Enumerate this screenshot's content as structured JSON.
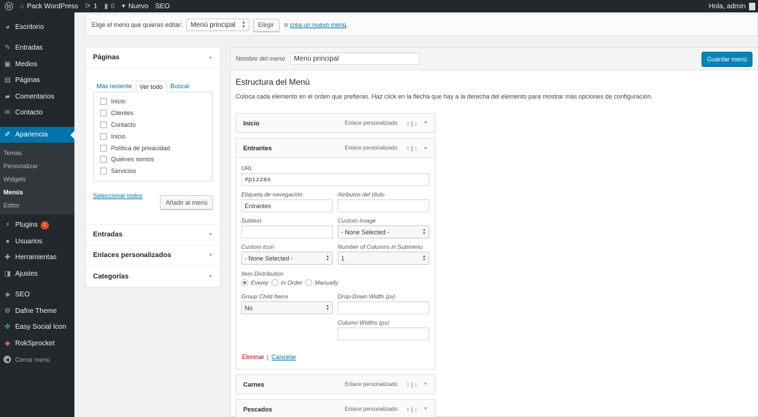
{
  "adminbar": {
    "site_name": "Pack WordPress",
    "updates_count": "1",
    "comments_count": "0",
    "new_label": "Nuevo",
    "seo_label": "SEO",
    "greeting": "Hola, admin"
  },
  "sidebar": {
    "items": [
      {
        "label": "Escritorio",
        "icon": "dashboard-icon"
      },
      {
        "label": "Entradas",
        "icon": "pin-icon"
      },
      {
        "label": "Medios",
        "icon": "media-icon"
      },
      {
        "label": "Páginas",
        "icon": "page-icon"
      },
      {
        "label": "Comentarios",
        "icon": "comment-icon"
      },
      {
        "label": "Contacto",
        "icon": "mail-icon"
      },
      {
        "label": "Apariencia",
        "icon": "brush-icon"
      }
    ],
    "submenu": [
      "Temas",
      "Personalizar",
      "Widgets",
      "Menús",
      "Editor"
    ],
    "items2": [
      {
        "label": "Plugins",
        "icon": "plug-icon",
        "badge": "1"
      },
      {
        "label": "Usuarios",
        "icon": "users-icon"
      },
      {
        "label": "Herramientas",
        "icon": "wrench-icon"
      },
      {
        "label": "Ajustes",
        "icon": "settings-icon"
      },
      {
        "label": "SEO",
        "icon": "seo-icon"
      },
      {
        "label": "Dafne Theme",
        "icon": "theme-icon"
      },
      {
        "label": "Easy Social Icon",
        "icon": "social-icon"
      },
      {
        "label": "RokSprocket",
        "icon": "rocket-icon"
      }
    ],
    "collapse_label": "Cerrar menú"
  },
  "manage": {
    "prompt": "Elige el menú que quieras editar:",
    "selected_menu": "Menú principal",
    "choose_button": "Elegir",
    "or_text": "o",
    "create_link": "crea un nuevo menú",
    "period": "."
  },
  "accordion": {
    "pages_title": "Páginas",
    "tabs": [
      "Más reciente",
      "Ver todo",
      "Buscar"
    ],
    "pages": [
      "Inicio",
      "Clientes",
      "Contacto",
      "Inicio",
      "Política de privacidad",
      "Quiénes somos",
      "Servicios"
    ],
    "select_all": "Seleccionar todos",
    "add_button": "Añadir al menú",
    "sections": [
      "Entradas",
      "Enlaces personalizados",
      "Categorías"
    ]
  },
  "editor": {
    "menu_name_label": "Nombre del menú",
    "menu_name_value": "Menú principal",
    "save_button": "Guardar menú",
    "structure_title": "Estructura del Menú",
    "structure_desc": "Coloca cada elemento en el orden que prefieras. Haz click en la flecha que hay a la derecha del elemento para mostrar más opciones de configuración.",
    "item_type": "Enlace personalizado",
    "move_arrows": "↑ | ↓",
    "items": [
      "Inicio",
      "Entrantes",
      "Carnes",
      "Pescados"
    ]
  },
  "settings": {
    "url_label": "URL",
    "url_value": "#pizzas",
    "nav_label": "Etiqueta de navegación",
    "nav_value": "Entrantes",
    "title_attr_label": "Atributos del título",
    "subtext_label": "Subtext",
    "custom_image_label": "Custom Image",
    "custom_image_value": "- None Selected -",
    "custom_icon_label": "Custom Icon",
    "custom_icon_value": "- None Selected -",
    "columns_label": "Number of Columns in Submenu",
    "columns_value": "1",
    "distribution_label": "Item Distribution",
    "distribution_options": [
      "Evenly",
      "In Order",
      "Manually"
    ],
    "group_label": "Group Child Items",
    "group_value": "No",
    "dropdown_width_label": "Drop-Down Width (px)",
    "column_widths_label": "Column Widths (px)",
    "delete_link": "Eliminar",
    "separator": "|",
    "cancel_link": "Cancelar"
  },
  "colors": {
    "adminbar_bg": "#23282d",
    "accent": "#0073aa",
    "primary_button": "#0085ba",
    "badge": "#d54e21",
    "danger": "#aa0000"
  }
}
